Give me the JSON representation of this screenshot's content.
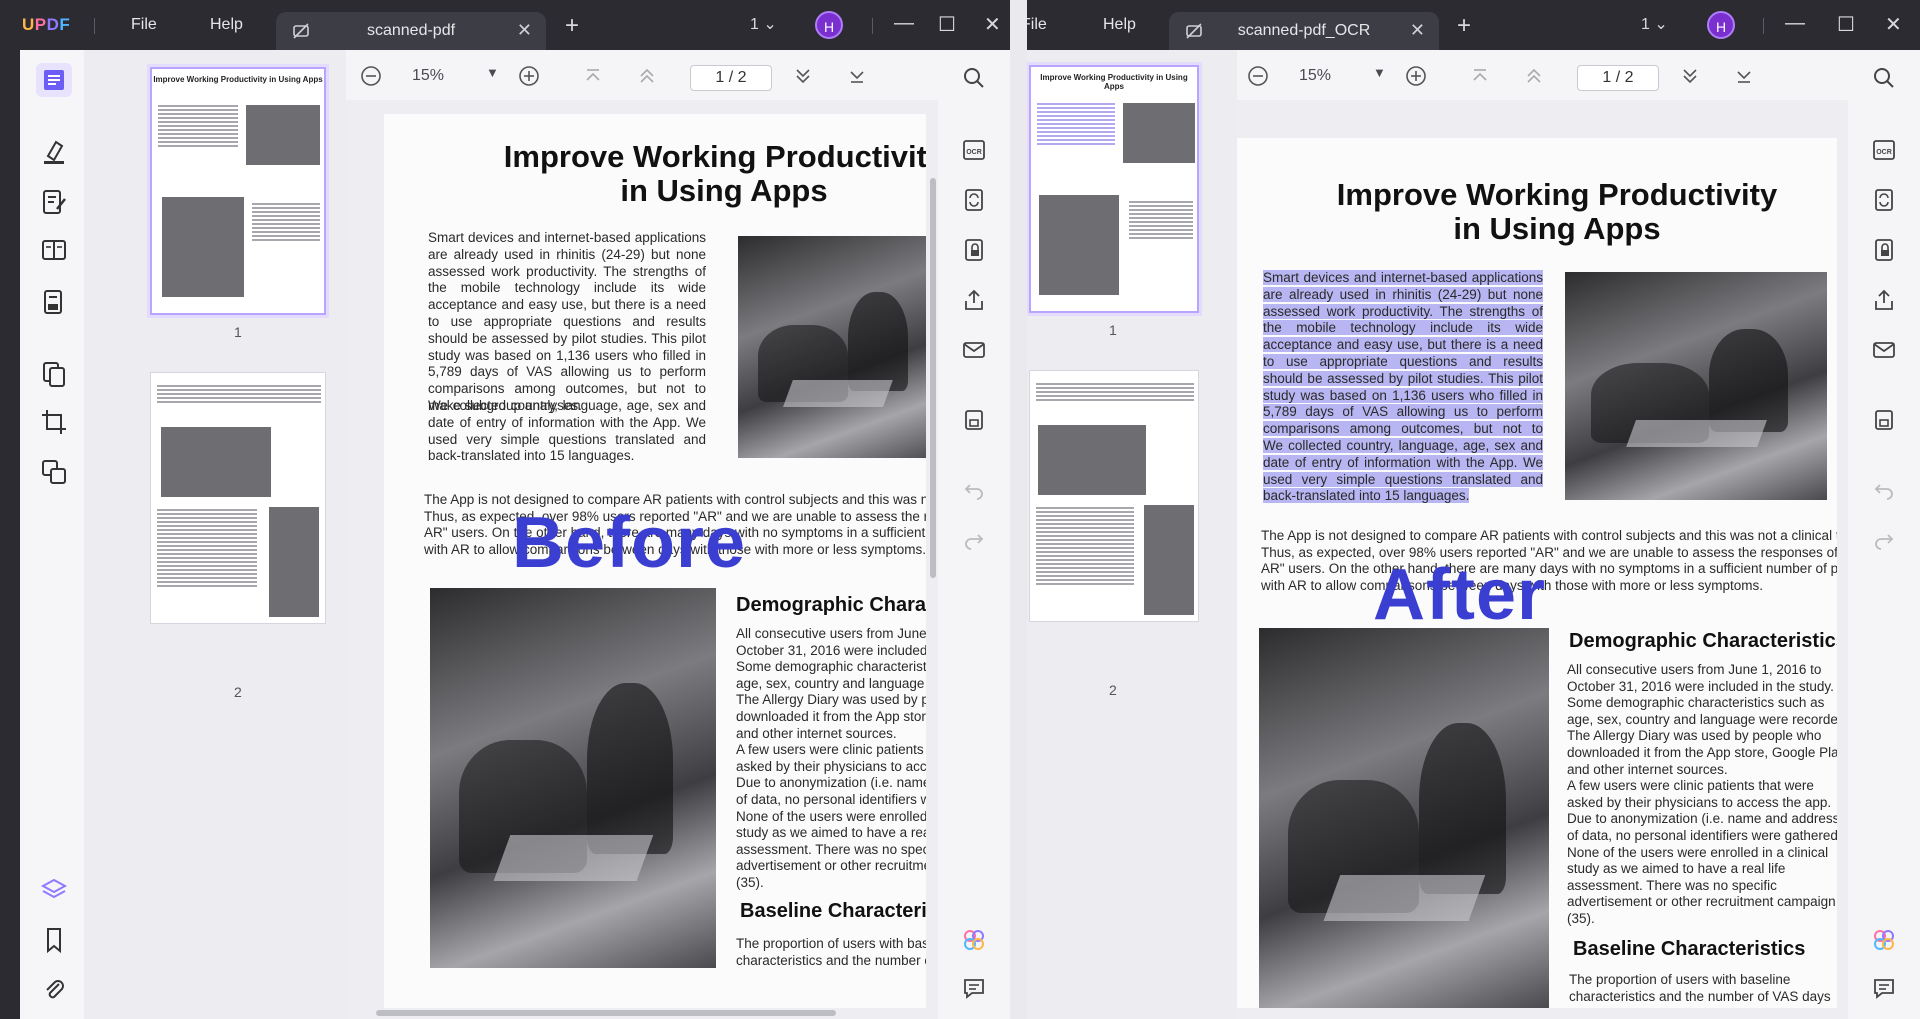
{
  "app": {
    "logo": [
      "U",
      "P",
      "D",
      "F"
    ],
    "menu": {
      "file": "File",
      "help": "Help"
    },
    "avatar_initial": "H"
  },
  "window_a": {
    "tab_title": "scanned-pdf",
    "page_count": "1",
    "zoom": "15%",
    "page_current": "1",
    "page_total": "2",
    "page_sep": "/",
    "overlay_label": "Before",
    "thumb_labels": [
      "1",
      "2"
    ],
    "thumb_title": "Improve Working Productivity in Using Apps"
  },
  "window_b": {
    "tab_title": "scanned-pdf_OCR",
    "page_count": "1",
    "zoom": "15%",
    "page_current": "1",
    "page_total": "2",
    "page_sep": "/",
    "overlay_label": "After",
    "thumb_labels": [
      "1",
      "2"
    ]
  },
  "document": {
    "title_line1": "Improve Working Productivity",
    "title_line2": "in Using Apps",
    "para1": "Smart devices and internet-based applications are already used in rhinitis (24-29) but none assessed work productivity. The strengths of the mobile technology include its wide acceptance and easy use, but there is a need to use appropriate questions and results should be assessed by pilot studies. This pilot study was based on 1,136 users who filled in 5,789 days of VAS allowing us to perform comparisons among outcomes, but not to make subgroup analyses.",
    "para2": "We collected country, language, age, sex and date of entry of information with the App. We used very simple questions translated and back-translated into 15 languages.",
    "wide_line1": "The App is not designed to compare AR patients with control subjects and this was not a clinical trial.",
    "wide_line2": "Thus, as expected, over 98% users reported \"AR\" and we are unable to assess the responses of \"non-",
    "wide_line3": "AR\" users. On the other hand, there are many days with no symptoms in a sufficient number of persons",
    "wide_line4": "with AR to allow comparisons between days with those with more or less symptoms.",
    "demo_heading": "Demographic Characteristics",
    "demo_lines": [
      "All consecutive users from June 1, 2016 to",
      "October 31, 2016 were included in the study.",
      "Some demographic characteristics such as",
      "age, sex, country and language were recorded.",
      "The Allergy Diary was used by people who",
      "downloaded it from the App store, Google Play,",
      "and other internet sources.",
      "A few users were clinic patients that were",
      "asked by their physicians to access the app.",
      "Due to anonymization (i.e. name and address",
      "of data, no personal identifiers were gathered.",
      "None of the users were enrolled in a clinical",
      "study as we aimed to have a real life",
      "assessment. There was no specific",
      "advertisement or other recruitment campaign",
      "(35)."
    ],
    "baseline_heading": "Baseline Characteristics",
    "baseline_lines": [
      "The proportion of users with baseline",
      "characteristics and the number of VAS days"
    ]
  },
  "icons": {
    "left": [
      "reader-icon",
      "comment-highlighter-icon",
      "edit-pdf-icon",
      "page-view-icon",
      "fill-sign-icon",
      "organize-pages-icon",
      "crop-icon",
      "compare-icon",
      "layers-icon",
      "bookmark-icon",
      "attachment-icon"
    ],
    "right": [
      "search-icon",
      "ocr-icon",
      "convert-icon",
      "protect-icon",
      "share-icon",
      "email-icon",
      "save-icon",
      "undo-icon",
      "redo-icon",
      "ai-assistant-icon",
      "comments-panel-icon"
    ]
  },
  "colors": {
    "accent": "#8f79ff",
    "overlay_text": "#3b3fd1",
    "ocr_highlight": "#b8b6f2",
    "titlebar": "#2b2b31"
  }
}
